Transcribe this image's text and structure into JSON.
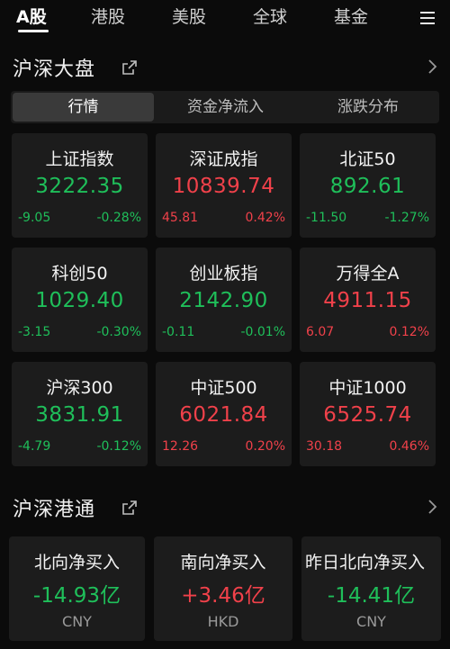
{
  "top_tabs": [
    "A股",
    "港股",
    "美股",
    "全球",
    "基金"
  ],
  "section1": {
    "title": "沪深大盘"
  },
  "segments": [
    "行情",
    "资金净流入",
    "涨跌分布"
  ],
  "indices": [
    {
      "name": "上证指数",
      "price": "3222.35",
      "change": "-9.05",
      "pct": "-0.28%",
      "trend": "down"
    },
    {
      "name": "深证成指",
      "price": "10839.74",
      "change": "45.81",
      "pct": "0.42%",
      "trend": "up"
    },
    {
      "name": "北证50",
      "price": "892.61",
      "change": "-11.50",
      "pct": "-1.27%",
      "trend": "down"
    },
    {
      "name": "科创50",
      "price": "1029.40",
      "change": "-3.15",
      "pct": "-0.30%",
      "trend": "down"
    },
    {
      "name": "创业板指",
      "price": "2142.90",
      "change": "-0.11",
      "pct": "-0.01%",
      "trend": "down"
    },
    {
      "name": "万得全A",
      "price": "4911.15",
      "change": "6.07",
      "pct": "0.12%",
      "trend": "up"
    },
    {
      "name": "沪深300",
      "price": "3831.91",
      "change": "-4.79",
      "pct": "-0.12%",
      "trend": "down"
    },
    {
      "name": "中证500",
      "price": "6021.84",
      "change": "12.26",
      "pct": "0.20%",
      "trend": "up"
    },
    {
      "name": "中证1000",
      "price": "6525.74",
      "change": "30.18",
      "pct": "0.46%",
      "trend": "up"
    }
  ],
  "section2": {
    "title": "沪深港通"
  },
  "flows": [
    {
      "name": "北向净买入",
      "value": "-14.93亿",
      "currency": "CNY",
      "trend": "down"
    },
    {
      "name": "南向净买入",
      "value": "+3.46亿",
      "currency": "HKD",
      "trend": "up"
    },
    {
      "name": "昨日北向净买入",
      "value": "-14.41亿",
      "currency": "CNY",
      "trend": "down"
    }
  ],
  "colors": {
    "up": "#f0414a",
    "down": "#1fbf5a",
    "background": "#0b0b0b",
    "card": "#1c1c1c"
  },
  "icons": [
    "menu-icon",
    "external-link-icon",
    "chevron-right-icon"
  ]
}
